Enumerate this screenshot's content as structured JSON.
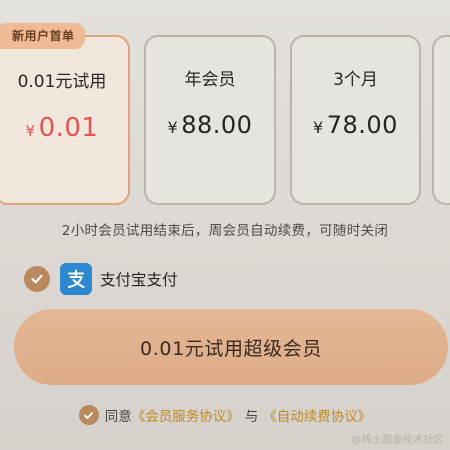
{
  "plans": [
    {
      "badge": "新用户首单",
      "name": "0.01元试用",
      "currency": "¥",
      "price": "0.01",
      "selected": true
    },
    {
      "name": "年会员",
      "currency": "¥",
      "price": "88.00",
      "selected": false
    },
    {
      "name": "3个月",
      "currency": "¥",
      "price": "78.00",
      "selected": false
    }
  ],
  "renew_note": "2小时会员试用结束后，周会员自动续费，可随时关闭",
  "payment": {
    "method_label": "支付宝支付",
    "icon": "alipay-icon",
    "selected": true
  },
  "cta_label": "0.01元试用超级会员",
  "agreement": {
    "prefix": "同意",
    "link1": "《会员服务协议》",
    "joiner": "与",
    "link2": "《自动续费协议》"
  },
  "watermark": "@稀土掘金技术社区",
  "colors": {
    "accent": "#e0a37a",
    "price_red": "#e6544f",
    "check": "#b98a60",
    "link": "#c28a1e",
    "alipay_blue": "#2e88cf"
  }
}
